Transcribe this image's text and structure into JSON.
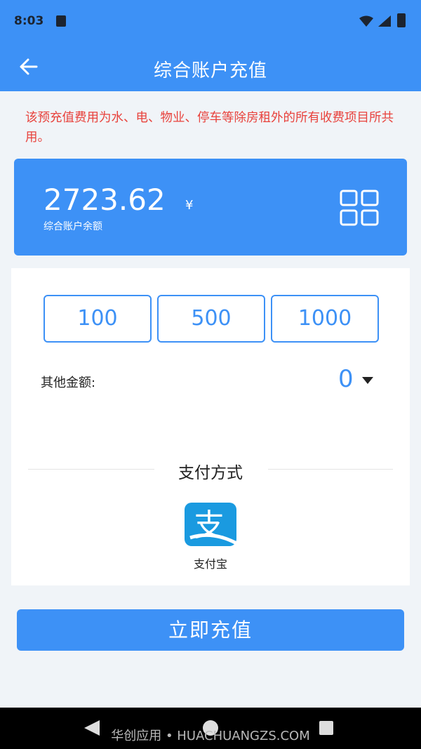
{
  "status_bar": {
    "time": "8:03"
  },
  "header": {
    "title": "综合账户充值"
  },
  "notice": "该预充值费用为水、电、物业、停车等除房租外的所有收费项目所共用。",
  "balance": {
    "amount": "2723.62",
    "unit": "¥",
    "label": "综合账户余额"
  },
  "amount_options": [
    "100",
    "500",
    "1000"
  ],
  "other_amount": {
    "label": "其他金额:",
    "value": "0"
  },
  "payment": {
    "title": "支付方式",
    "method_label": "支付宝",
    "method_icon_text": "支"
  },
  "submit_label": "立即充值",
  "watermark": "华创应用 • HUACHUANGZS.COM",
  "colors": {
    "primary": "#3d91f6",
    "notice": "#e8423c"
  }
}
